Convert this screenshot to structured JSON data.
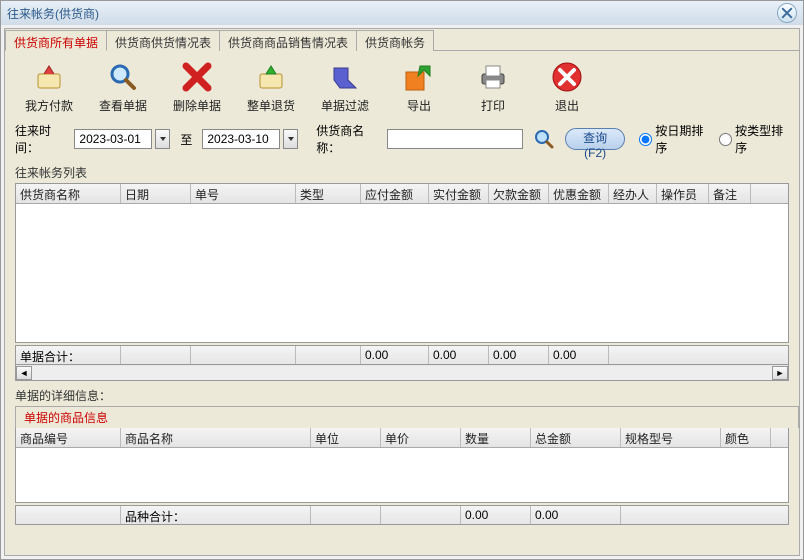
{
  "window": {
    "title": "往来帐务(供货商)"
  },
  "tabs": [
    "供货商所有单据",
    "供货商供货情况表",
    "供货商商品销售情况表",
    "供货商帐务"
  ],
  "toolbar": [
    {
      "key": "pay",
      "label": "我方付款",
      "icon": "pay-icon"
    },
    {
      "key": "view",
      "label": "查看单据",
      "icon": "magnifier-icon"
    },
    {
      "key": "delete",
      "label": "删除单据",
      "icon": "cross-icon"
    },
    {
      "key": "return",
      "label": "整单退货",
      "icon": "return-icon"
    },
    {
      "key": "filter",
      "label": "单据过滤",
      "icon": "filter-icon"
    },
    {
      "key": "export",
      "label": "导出",
      "icon": "export-icon"
    },
    {
      "key": "print",
      "label": "打印",
      "icon": "print-icon"
    },
    {
      "key": "exit",
      "label": "退出",
      "icon": "exit-icon"
    }
  ],
  "filter": {
    "time_label": "往来时间：",
    "date_from": "2023-03-01",
    "to_label": "至",
    "date_to": "2023-03-10",
    "supplier_label": "供货商名称：",
    "supplier_name": "",
    "query_btn": "查询(F2)",
    "sort_date": "按日期排序",
    "sort_type": "按类型排序"
  },
  "list_section_title": "往来帐务列表",
  "grid1_headers": [
    "供货商名称",
    "日期",
    "单号",
    "类型",
    "应付金额",
    "实付金额",
    "欠款金额",
    "优惠金额",
    "经办人",
    "操作员",
    "备注"
  ],
  "totals1": {
    "label": "单据合计：",
    "cells": [
      "",
      "",
      "",
      "0.00",
      "0.00",
      "0.00",
      "0.00"
    ]
  },
  "detail_label": "单据的详细信息：",
  "subtab": "单据的商品信息",
  "grid2_headers": [
    "商品编号",
    "商品名称",
    "单位",
    "单价",
    "数量",
    "总金额",
    "规格型号",
    "颜色"
  ],
  "totals2": {
    "label": "品种合计：",
    "cells": [
      "",
      "",
      "0.00",
      "0.00"
    ]
  },
  "chart_data": null
}
